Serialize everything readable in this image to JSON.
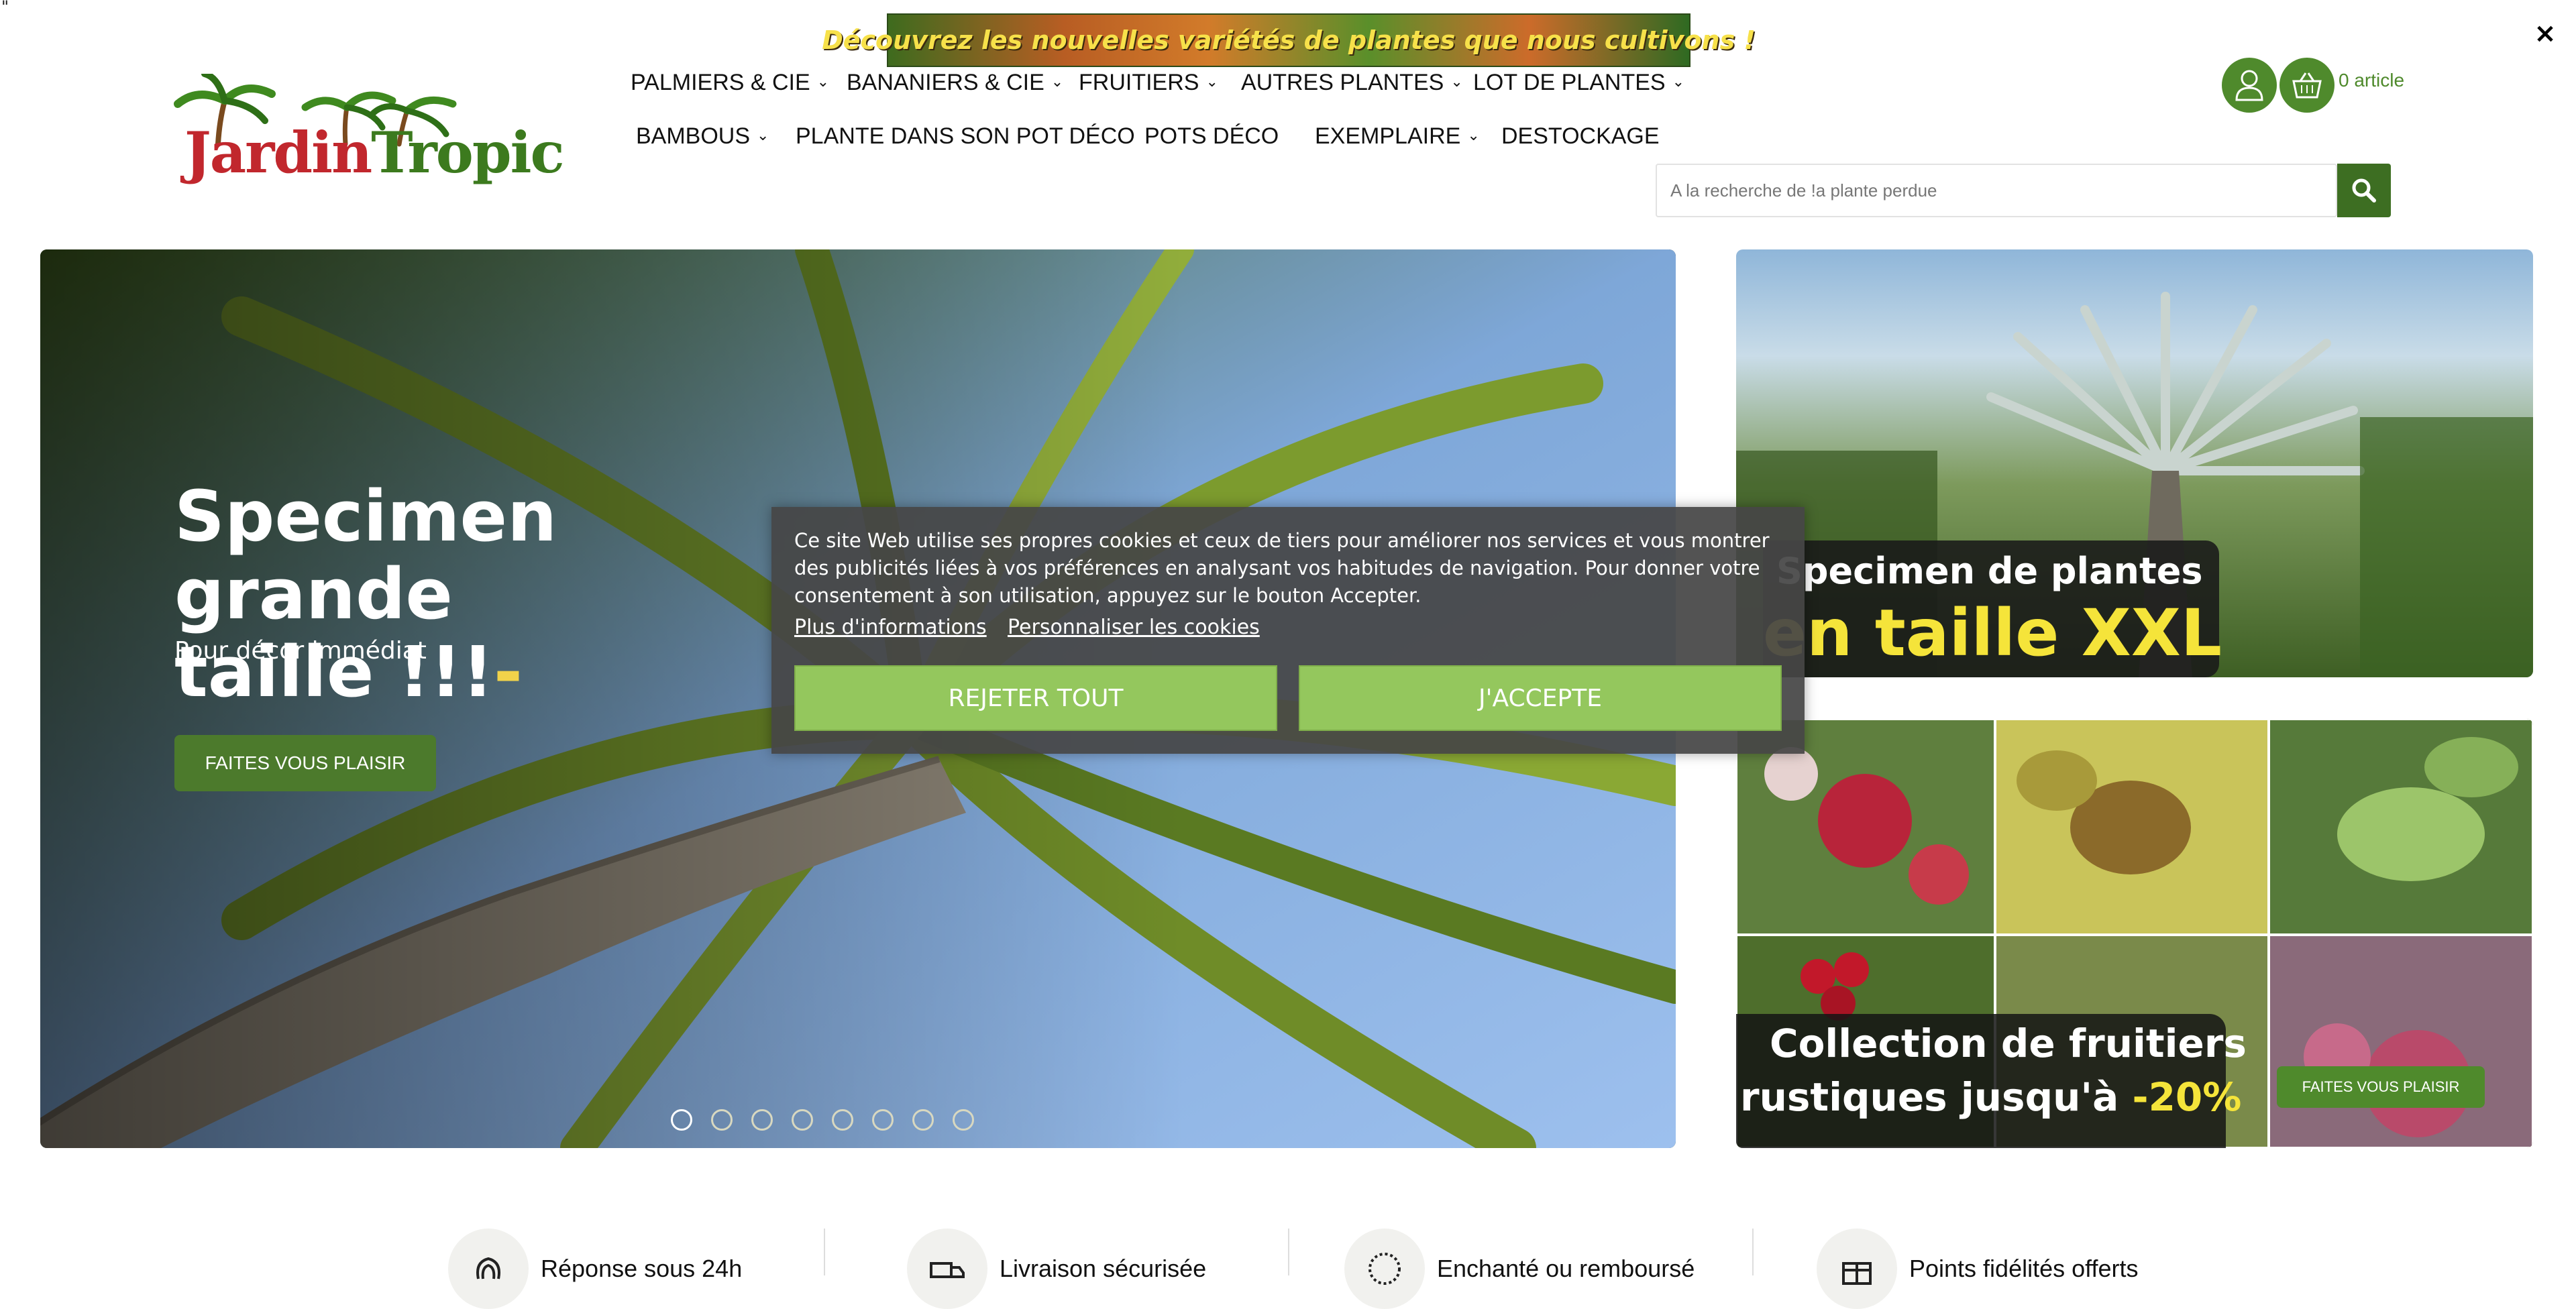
{
  "stray_char": "\"",
  "promo_banner": {
    "text": "Découvrez les nouvelles variétés de plantes que nous cultivons !"
  },
  "close_label": "×",
  "logo": {
    "part1": "Jardin",
    "part2": "Tropic"
  },
  "nav": {
    "row1": [
      {
        "label": "PALMIERS & CIE",
        "dropdown": true
      },
      {
        "label": "BANANIERS & CIE",
        "dropdown": true
      },
      {
        "label": "FRUITIERS",
        "dropdown": true
      },
      {
        "label": "AUTRES PLANTES",
        "dropdown": true
      },
      {
        "label": "LOT DE PLANTES",
        "dropdown": true
      }
    ],
    "row2": [
      {
        "label": "BAMBOUS",
        "dropdown": true
      },
      {
        "label": "PLANTE DANS SON POT DÉCO",
        "dropdown": false
      },
      {
        "label": "POTS DÉCO",
        "dropdown": false
      },
      {
        "label": "EXEMPLAIRE",
        "dropdown": true
      },
      {
        "label": "DESTOCKAGE",
        "dropdown": false
      }
    ],
    "chevron": "⌄"
  },
  "header": {
    "account_icon": "user-icon",
    "cart_icon": "basket-icon",
    "cart_text": "0 article"
  },
  "search": {
    "placeholder": "A la recherche de !a plante perdue",
    "value": "",
    "icon": "search-icon"
  },
  "hero": {
    "title_line1": "Specimen grande",
    "title_line2": "taille !!!",
    "title_dash": "-",
    "subtitle": "Pour décor immédiat",
    "button": "FAITES VOUS PLAISIR",
    "slides": 8,
    "active_slide": 1
  },
  "promo_xxl": {
    "line1": "Specimen de plantes",
    "line2": "en taille XXL"
  },
  "promo_fruit": {
    "line1": "Collection de fruitiers",
    "line2": "rustiques jusqu'à",
    "discount": "-20%",
    "button": "FAITES VOUS PLAISIR"
  },
  "cookie": {
    "text": "Ce site Web utilise ses propres cookies et ceux de tiers pour améliorer nos services et vous montrer des publicités liées à vos préférences en analysant vos habitudes de navigation. Pour donner votre consentement à son utilisation, appuyez sur le bouton Accepter.",
    "more_info": "Plus d'informations",
    "customize": "Personnaliser les cookies",
    "reject": "REJETER TOUT",
    "accept": "J'ACCEPTE"
  },
  "reassurance": [
    {
      "icon": "fingerprint-icon",
      "label": "Réponse sous 24h"
    },
    {
      "icon": "truck-icon",
      "label": "Livraison sécurisée"
    },
    {
      "icon": "smile-icon",
      "label": "Enchanté ou remboursé"
    },
    {
      "icon": "gift-icon",
      "label": "Points fidélités offerts"
    }
  ],
  "colors": {
    "brand_green": "#4f8a2c",
    "accent_yellow": "#f5e43a",
    "cookie_button": "#94c75d"
  }
}
